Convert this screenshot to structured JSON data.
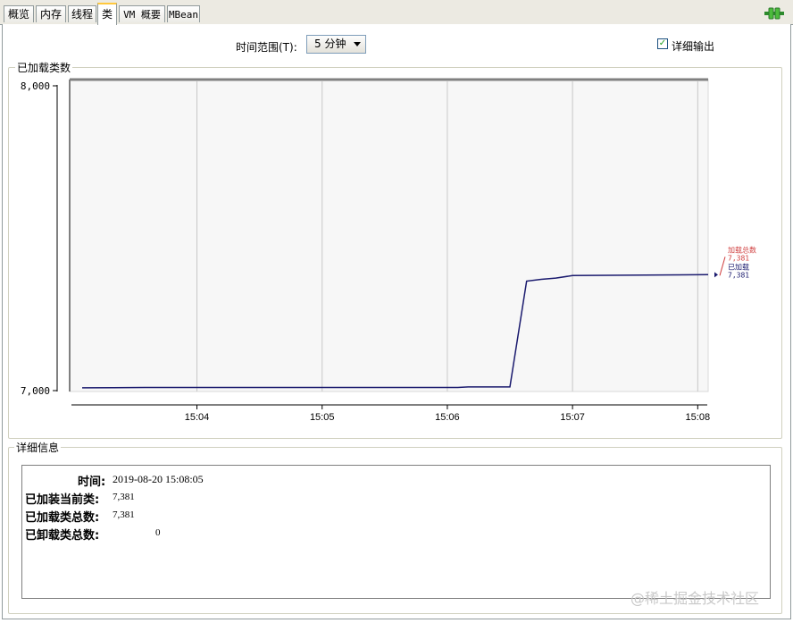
{
  "tabs": [
    {
      "label": "概览",
      "active": false
    },
    {
      "label": "内存",
      "active": false
    },
    {
      "label": "线程",
      "active": false
    },
    {
      "label": "类",
      "active": true
    },
    {
      "label": "VM 概要",
      "active": false
    },
    {
      "label": "MBean",
      "active": false
    }
  ],
  "toolbar": {
    "time_range_label": "时间范围(T):",
    "time_range_value": "5 分钟",
    "detail_output_label": "详细输出",
    "detail_output_checked": true
  },
  "chart_panel": {
    "title": "已加载类数"
  },
  "chart_data": {
    "type": "line",
    "y_ticks": [
      "8,000",
      "7,000"
    ],
    "ylim": [
      7000,
      8000
    ],
    "x_ticks": [
      "15:04",
      "15:05",
      "15:06",
      "15:07",
      "15:08"
    ],
    "xlim": [
      "15:03:05",
      "15:08:05"
    ],
    "series": [
      {
        "name": "已加载",
        "color": "#1a1a6e",
        "x": [
          "15:03:05",
          "15:03:35",
          "15:06:05",
          "15:06:10",
          "15:06:30",
          "15:06:38",
          "15:06:45",
          "15:06:52",
          "15:07:00",
          "15:08:05"
        ],
        "y": [
          7012,
          7013,
          7013,
          7015,
          7015,
          7360,
          7366,
          7370,
          7378,
          7381
        ]
      }
    ],
    "legend": [
      {
        "label": "加载总数",
        "value": "7,381",
        "color": "#d04040"
      },
      {
        "label": "已加载",
        "value": "7,381",
        "color": "#1a1a6e"
      }
    ]
  },
  "details": {
    "title": "详细信息",
    "rows": [
      {
        "label": "时间:",
        "value": "2019-08-20 15:08:05"
      },
      {
        "label": "已加装当前类:",
        "value": "7,381"
      },
      {
        "label": "已加载类总数:",
        "value": "7,381"
      },
      {
        "label": "已卸载类总数:",
        "value": "0"
      }
    ]
  },
  "watermark": "@稀土掘金技术社区"
}
